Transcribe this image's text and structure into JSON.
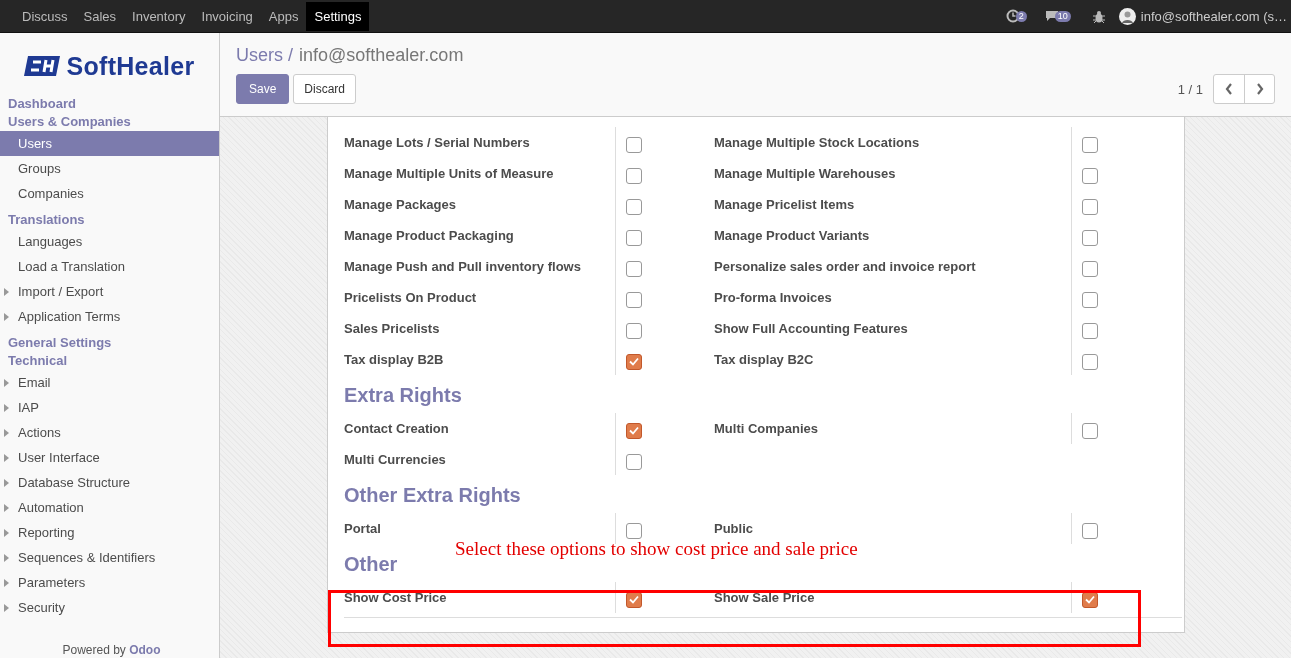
{
  "top_menu": [
    {
      "label": "Discuss",
      "selected": false
    },
    {
      "label": "Sales",
      "selected": false
    },
    {
      "label": "Inventory",
      "selected": false
    },
    {
      "label": "Invoicing",
      "selected": false
    },
    {
      "label": "Apps",
      "selected": false
    },
    {
      "label": "Settings",
      "selected": true
    }
  ],
  "systray": {
    "activity_count": "2",
    "message_count": "10",
    "user": "info@softhealer.com (s…"
  },
  "logo": {
    "text": "SoftHealer"
  },
  "sidebar": [
    {
      "title": "Dashboard"
    },
    {
      "title": "Users & Companies",
      "items": [
        {
          "label": "Users",
          "selected": true,
          "expandable": false
        },
        {
          "label": "Groups",
          "selected": false,
          "expandable": false
        },
        {
          "label": "Companies",
          "selected": false,
          "expandable": false
        }
      ]
    },
    {
      "title": "Translations",
      "items": [
        {
          "label": "Languages",
          "selected": false,
          "expandable": false
        },
        {
          "label": "Load a Translation",
          "selected": false,
          "expandable": false
        },
        {
          "label": "Import / Export",
          "selected": false,
          "expandable": true
        },
        {
          "label": "Application Terms",
          "selected": false,
          "expandable": true
        }
      ]
    },
    {
      "title": "General Settings"
    },
    {
      "title": "Technical",
      "items": [
        {
          "label": "Email",
          "selected": false,
          "expandable": true
        },
        {
          "label": "IAP",
          "selected": false,
          "expandable": true
        },
        {
          "label": "Actions",
          "selected": false,
          "expandable": true
        },
        {
          "label": "User Interface",
          "selected": false,
          "expandable": true
        },
        {
          "label": "Database Structure",
          "selected": false,
          "expandable": true
        },
        {
          "label": "Automation",
          "selected": false,
          "expandable": true
        },
        {
          "label": "Reporting",
          "selected": false,
          "expandable": true
        },
        {
          "label": "Sequences & Identifiers",
          "selected": false,
          "expandable": true
        },
        {
          "label": "Parameters",
          "selected": false,
          "expandable": true
        },
        {
          "label": "Security",
          "selected": false,
          "expandable": true
        }
      ]
    }
  ],
  "powered_by": {
    "text": "Powered by",
    "link": "Odoo"
  },
  "breadcrumb": {
    "parent": "Users /",
    "current": "info@softhealer.com"
  },
  "buttons": {
    "save": "Save",
    "discard": "Discard"
  },
  "pager": {
    "text": "1 / 1"
  },
  "sections": [
    {
      "options": [
        {
          "label": "Manage Lots / Serial Numbers",
          "checked": false
        },
        {
          "label": "Manage Multiple Stock Locations",
          "checked": false
        },
        {
          "label": "Manage Multiple Units of Measure",
          "checked": false
        },
        {
          "label": "Manage Multiple Warehouses",
          "checked": false
        },
        {
          "label": "Manage Packages",
          "checked": false
        },
        {
          "label": "Manage Pricelist Items",
          "checked": false
        },
        {
          "label": "Manage Product Packaging",
          "checked": false
        },
        {
          "label": "Manage Product Variants",
          "checked": false
        },
        {
          "label": "Manage Push and Pull inventory flows",
          "checked": false
        },
        {
          "label": "Personalize sales order and invoice report",
          "checked": false
        },
        {
          "label": "Pricelists On Product",
          "checked": false
        },
        {
          "label": "Pro-forma Invoices",
          "checked": false
        },
        {
          "label": "Sales Pricelists",
          "checked": false
        },
        {
          "label": "Show Full Accounting Features",
          "checked": false
        },
        {
          "label": "Tax display B2B",
          "checked": true
        },
        {
          "label": "Tax display B2C",
          "checked": false
        }
      ]
    },
    {
      "title": "Extra Rights",
      "options": [
        {
          "label": "Contact Creation",
          "checked": true
        },
        {
          "label": "Multi Companies",
          "checked": false
        },
        {
          "label": "Multi Currencies",
          "checked": false
        }
      ]
    },
    {
      "title": "Other Extra Rights",
      "options": [
        {
          "label": "Portal",
          "checked": false
        },
        {
          "label": "Public",
          "checked": false
        }
      ]
    },
    {
      "title": "Other",
      "annotation": "Select these options to show cost price and sale price",
      "options": [
        {
          "label": "Show Cost Price",
          "checked": true
        },
        {
          "label": "Show Sale Price",
          "checked": true
        }
      ]
    }
  ]
}
